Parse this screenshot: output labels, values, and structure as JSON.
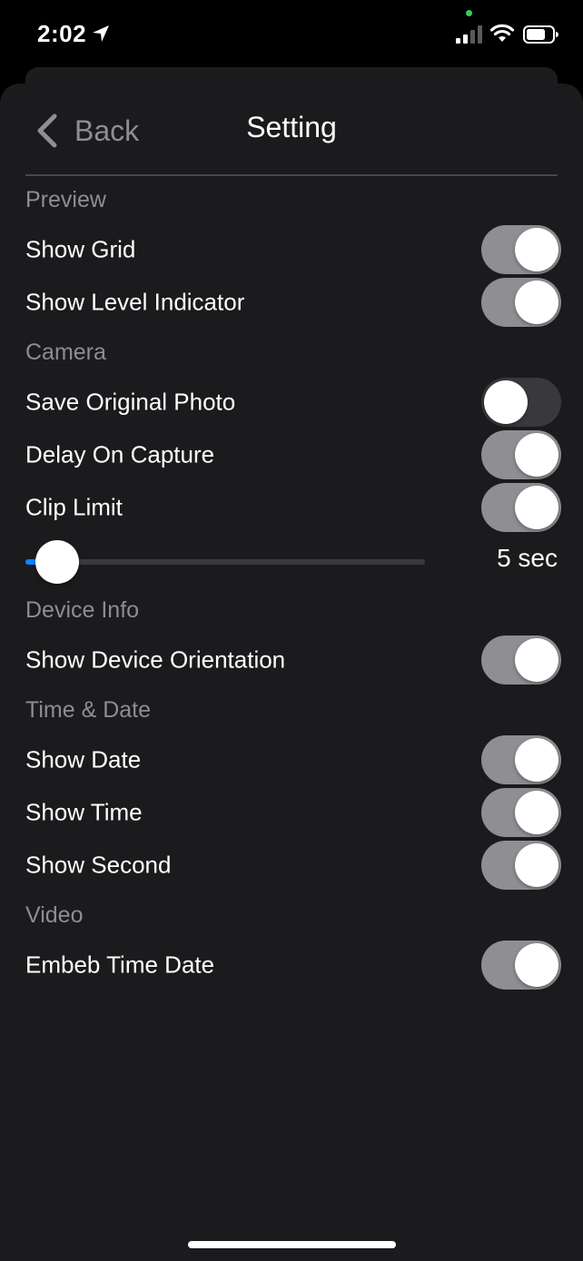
{
  "status_bar": {
    "time": "2:02",
    "icons": [
      "location-arrow-icon",
      "cellular-signal-icon",
      "wifi-icon",
      "battery-icon"
    ]
  },
  "nav": {
    "back_label": "Back",
    "title": "Setting"
  },
  "sections": {
    "preview": {
      "header": "Preview",
      "show_grid": {
        "label": "Show Grid",
        "on": true
      },
      "show_level_indicator": {
        "label": "Show Level Indicator",
        "on": true
      }
    },
    "camera": {
      "header": "Camera",
      "save_original_photo": {
        "label": "Save Original Photo",
        "on": false
      },
      "delay_on_capture": {
        "label": "Delay On Capture",
        "on": true
      },
      "clip_limit": {
        "label": "Clip Limit",
        "on": true
      },
      "clip_limit_slider": {
        "value_label": "5 sec",
        "level": 0.08
      }
    },
    "device_info": {
      "header": "Device Info",
      "show_device_orientation": {
        "label": "Show Device Orientation",
        "on": true
      }
    },
    "time_date": {
      "header": "Time & Date",
      "show_date": {
        "label": "Show Date",
        "on": true
      },
      "show_time": {
        "label": "Show Time",
        "on": true
      },
      "show_second": {
        "label": "Show Second",
        "on": true
      }
    },
    "video": {
      "header": "Video",
      "embeb_time_date": {
        "label": "Embeb Time Date",
        "on": true
      }
    }
  },
  "colors": {
    "sheet_background": "#1b1b1d",
    "toggle_on": "#8e8e93",
    "toggle_off": "#39393d",
    "section_header": "#8d8d92",
    "text": "#ffffff"
  }
}
